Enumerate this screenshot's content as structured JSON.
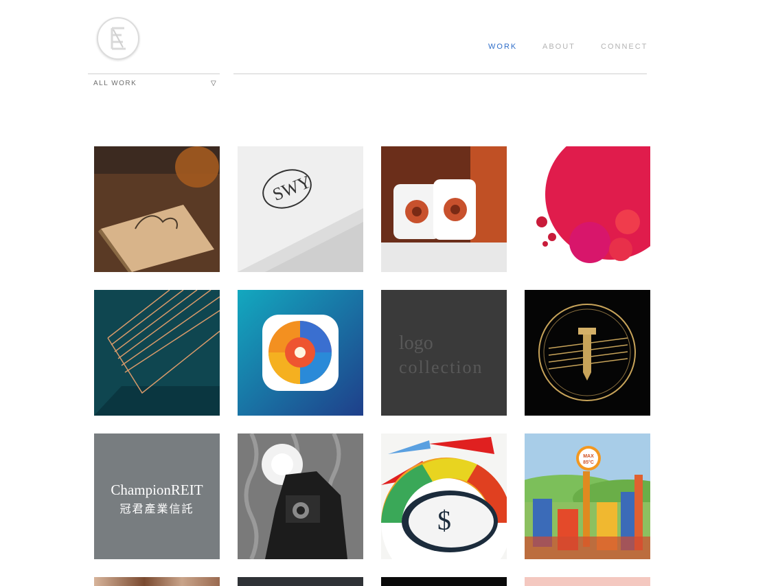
{
  "header": {
    "nav": [
      {
        "label": "WORK",
        "active": true
      },
      {
        "label": "ABOUT",
        "active": false
      },
      {
        "label": "CONNECT",
        "active": false
      }
    ],
    "logo": "monogram-logo"
  },
  "filter": {
    "selected": "ALL WORK",
    "icon": "triangle-down-icon"
  },
  "colors": {
    "accent": "#2f6ec9",
    "nav_inactive": "#b3b3b3",
    "divider": "#cfcfcf"
  },
  "portfolio": {
    "tiles": [
      {
        "name": "business-card-tile"
      },
      {
        "name": "sw-monogram-tile"
      },
      {
        "name": "speakers-tile"
      },
      {
        "name": "raspberry-dessert-tile"
      },
      {
        "name": "copper-pen-tile"
      },
      {
        "name": "color-wheel-app-icon-tile"
      },
      {
        "name": "logo-collection-tile",
        "text_line1": "logo",
        "text_line2": "collection"
      },
      {
        "name": "gold-screw-emblem-tile"
      },
      {
        "name": "champion-reit-tile",
        "text_line1": "ChampionREIT",
        "text_line2": "冠君產業信託"
      },
      {
        "name": "vintage-camera-tile"
      },
      {
        "name": "dollar-dial-tile"
      },
      {
        "name": "industrial-town-illustration-tile",
        "badge_line1": "MAX",
        "badge_line2": "85°C"
      },
      {
        "name": "partial-tile-1"
      },
      {
        "name": "partial-tile-2"
      },
      {
        "name": "partial-tile-3"
      },
      {
        "name": "partial-tile-4"
      }
    ]
  }
}
